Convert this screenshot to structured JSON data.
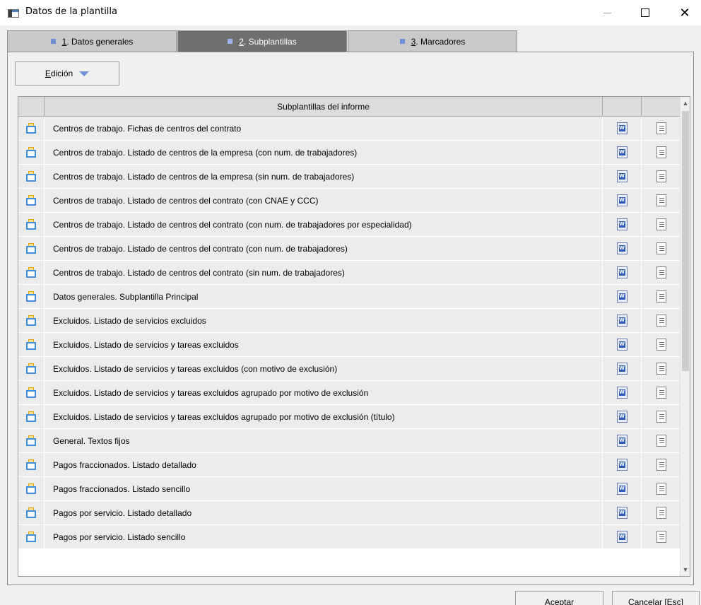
{
  "window": {
    "title": "Datos de la plantilla",
    "close_glyph": "✕"
  },
  "tabs": [
    {
      "num": "1",
      "label": ". Datos generales",
      "active": false
    },
    {
      "num": "2",
      "label": ". Subplantillas",
      "active": true
    },
    {
      "num": "3",
      "label": ". Marcadores",
      "active": false
    }
  ],
  "toolbar": {
    "edit_u": "E",
    "edit_rest": "dición"
  },
  "grid": {
    "header": "Subplantillas del informe",
    "rows": [
      "Centros de trabajo. Fichas de centros del contrato",
      "Centros de trabajo. Listado de centros de la empresa (con num. de trabajadores)",
      "Centros de trabajo. Listado de centros de la empresa (sin num. de trabajadores)",
      "Centros de trabajo. Listado de centros del contrato (con CNAE y CCC)",
      "Centros de trabajo. Listado de centros del contrato (con num. de trabajadores por especialidad)",
      "Centros de trabajo. Listado de centros del contrato (con num. de trabajadores)",
      "Centros de trabajo. Listado de centros del contrato (sin num. de trabajadores)",
      "Datos generales. Subplantilla Principal",
      "Excluidos. Listado de servicios excluidos",
      "Excluidos. Listado de servicios y tareas excluidos",
      "Excluidos. Listado de servicios y tareas excluidos (con motivo de exclusión)",
      "Excluidos. Listado de servicios y tareas excluidos agrupado por motivo de exclusión",
      "Excluidos. Listado de servicios y tareas excluidos agrupado por motivo de exclusión (título)",
      "General. Textos fijos",
      "Pagos fraccionados. Listado detallado",
      "Pagos fraccionados. Listado sencillo",
      "Pagos por servicio. Listado detallado",
      "Pagos por servicio. Listado sencillo"
    ]
  },
  "footer": {
    "accept_label": "Aceptar",
    "cancel_label": "Cancelar [Esc]"
  }
}
